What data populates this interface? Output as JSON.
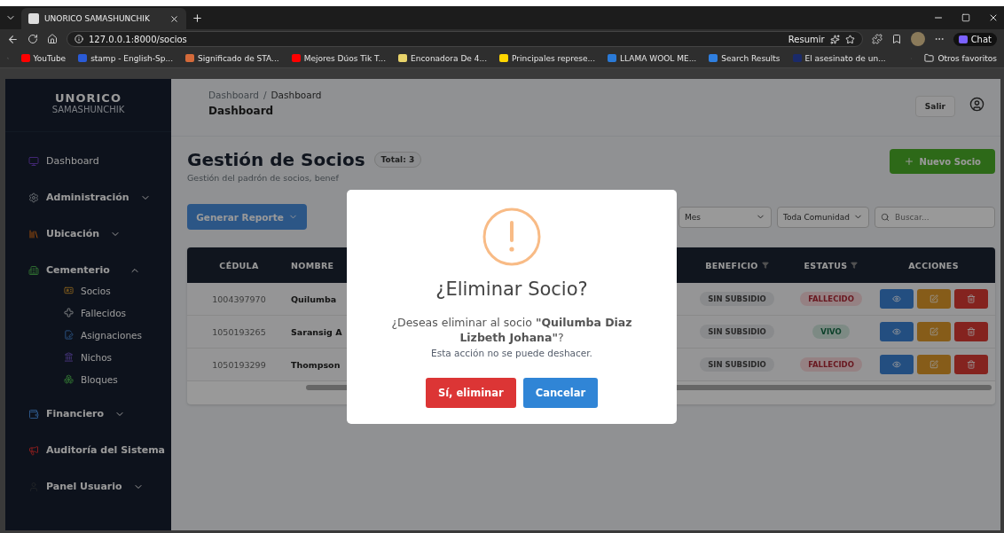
{
  "browser": {
    "tabs": [
      {
        "title": "UNORICO SAMASHUNCHIK",
        "selected": true
      }
    ],
    "url": "127.0.0.1:8000/socios",
    "summarize": "Resumir",
    "chat": "Chat",
    "bookmarks": [
      "YouTube",
      "stamp - English-Sp...",
      "Significado de STA...",
      "Mejores Dúos Tik T...",
      "Enconadora De 4...",
      "Principales represe...",
      "LLAMA WOOL ME...",
      "Search Results",
      "El asesinato de un..."
    ],
    "other_favorites": "Otros favoritos"
  },
  "sidebar": {
    "brand": {
      "title": "UNORICO",
      "subtitle": "SAMASHUNCHIK"
    },
    "items": [
      {
        "label": "Dashboard"
      },
      {
        "label": "Administración",
        "expanded": false
      },
      {
        "label": "Ubicación",
        "expanded": false
      },
      {
        "label": "Cementerio",
        "expanded": true,
        "children": [
          {
            "label": "Socios"
          },
          {
            "label": "Fallecidos"
          },
          {
            "label": "Asignaciones"
          },
          {
            "label": "Nichos"
          },
          {
            "label": "Bloques"
          }
        ]
      },
      {
        "label": "Financiero",
        "expanded": false
      },
      {
        "label": "Auditoría del Sistema"
      },
      {
        "label": "Panel Usuario",
        "expanded": false
      }
    ]
  },
  "header": {
    "breadcrumb": [
      "Dashboard",
      "Dashboard"
    ],
    "breadcrumb_separator": "/",
    "title": "Dashboard",
    "logout": "Salir"
  },
  "page": {
    "title": "Gestión de Socios",
    "total": "Total: 3",
    "subtitle": "Gestión del padrón de socios, benef",
    "new_button": "Nuevo Socio",
    "report_button": "Generar Reporte",
    "filters": {
      "month": "Mes",
      "community": "Toda Comunidad",
      "search_placeholder": "Buscar..."
    }
  },
  "table": {
    "columns": [
      "CÉDULA",
      "NOMBRE",
      "BENEFICIO",
      "ESTATUS",
      "ACCIONES"
    ],
    "rows": [
      {
        "cedula": "1004397970",
        "name": "Quilumba",
        "benefit": "SIN SUBSIDIO",
        "status": "FALLECIDO",
        "kind": "deceased"
      },
      {
        "cedula": "1050193265",
        "name": "Saransig A",
        "benefit": "SIN SUBSIDIO",
        "status": "VIVO",
        "kind": "alive"
      },
      {
        "cedula": "1050193299",
        "name": "Thompson",
        "benefit": "SIN SUBSIDIO",
        "status": "FALLECIDO",
        "kind": "deceased"
      }
    ]
  },
  "modal": {
    "title": "¿Eliminar Socio?",
    "message": "¿Deseas eliminar al socio **\"Quilumba Diaz Lizbeth Johana\"**?",
    "note": "Esta acción no se puede deshacer.",
    "confirm": "Sí, eliminar",
    "cancel": "Cancelar"
  }
}
